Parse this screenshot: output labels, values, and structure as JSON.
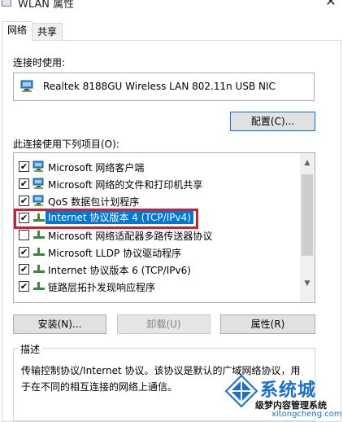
{
  "window": {
    "title": "WLAN 属性",
    "close_glyph": "✕"
  },
  "tabs": [
    {
      "label": "网络",
      "active": true
    },
    {
      "label": "共享",
      "active": false
    }
  ],
  "connect_using": {
    "label": "连接时使用:",
    "adapter": "Realtek 8188GU Wireless LAN 802.11n USB NIC",
    "configure_button": "配置(C)..."
  },
  "items_section": {
    "label": "此连接使用下列项目(O):",
    "items": [
      {
        "label": "Microsoft 网络客户端",
        "checked": true,
        "icon": "network-client-icon",
        "selected": false
      },
      {
        "label": "Microsoft 网络的文件和打印机共享",
        "checked": true,
        "icon": "network-client-icon",
        "selected": false
      },
      {
        "label": "QoS 数据包计划程序",
        "checked": true,
        "icon": "network-client-icon",
        "selected": false
      },
      {
        "label": "Internet 协议版本 4 (TCP/IPv4)",
        "checked": true,
        "icon": "protocol-icon",
        "selected": true
      },
      {
        "label": "Microsoft 网络适配器多路传送器协议",
        "checked": false,
        "icon": "protocol-icon",
        "selected": false
      },
      {
        "label": "Microsoft LLDP 协议驱动程序",
        "checked": true,
        "icon": "protocol-icon",
        "selected": false
      },
      {
        "label": "Internet 协议版本 6 (TCP/IPv6)",
        "checked": true,
        "icon": "protocol-icon",
        "selected": false
      },
      {
        "label": "链路层拓扑发现响应程序",
        "checked": true,
        "icon": "protocol-icon",
        "selected": false
      }
    ]
  },
  "buttons": {
    "install": "安装(N)...",
    "uninstall": "卸载(U)",
    "properties": "属性(R)"
  },
  "description": {
    "legend": "描述",
    "text": "传输控制协议/Internet 协议。该协议是默认的广域网络协议，用于在不同的相互连接的网络上通信。"
  },
  "watermark": {
    "title": "系统城",
    "subtitle": "级梦内容管理系统",
    "url": "xitongcheng.com"
  },
  "colors": {
    "selection": "#0078d7",
    "highlight_border": "#d02030",
    "watermark": "#1a6fd0"
  }
}
